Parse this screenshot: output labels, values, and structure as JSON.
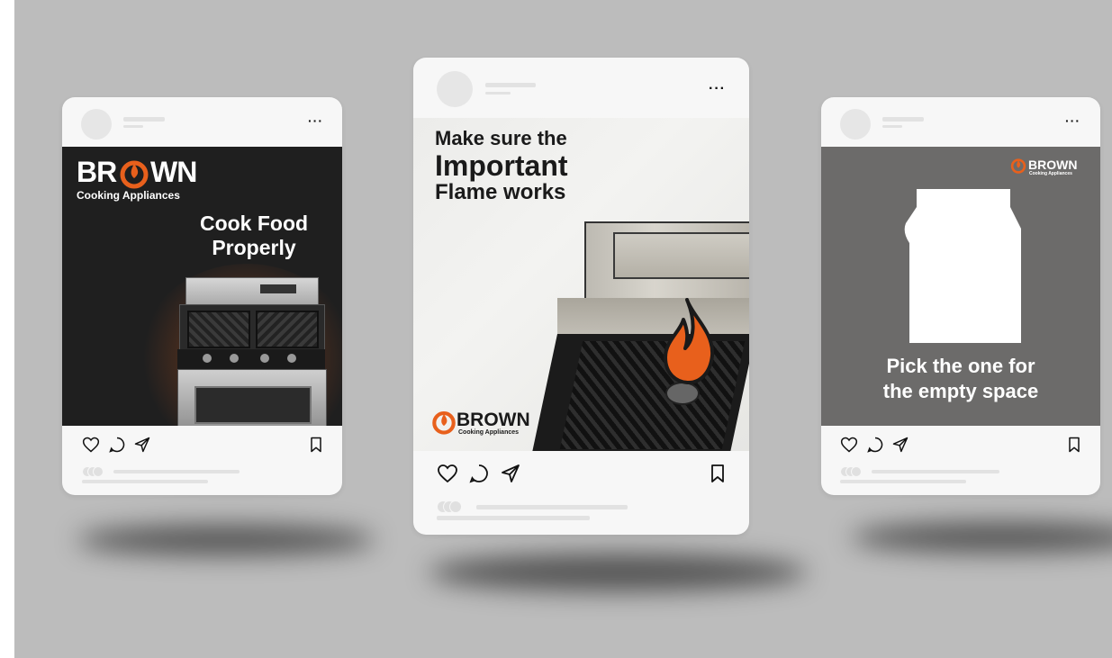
{
  "posts": [
    {
      "headline_line1": "Cook Food",
      "headline_line2": "Properly",
      "brand_prefix": "BR",
      "brand_suffix": "WN",
      "brand_sub": "Cooking Appliances"
    },
    {
      "headline_line1": "Make sure the",
      "headline_line2": "Important",
      "headline_line3": "Flame works",
      "brand_word": "BROWN",
      "brand_sub": "Cooking Appliances"
    },
    {
      "headline_line1": "Pick the one for",
      "headline_line2": "the empty space",
      "brand_word": "BROWN",
      "brand_sub": "Cooking Appliances"
    }
  ],
  "menu_glyph": "···",
  "colors": {
    "brand_orange": "#e8601c",
    "card_bg": "#f7f7f7",
    "stage_bg": "#bcbcbc",
    "post1_bg": "#1f1f1f",
    "post3_bg": "#6c6b6a"
  },
  "icons": [
    "heart-icon",
    "comment-icon",
    "share-icon",
    "bookmark-icon"
  ]
}
